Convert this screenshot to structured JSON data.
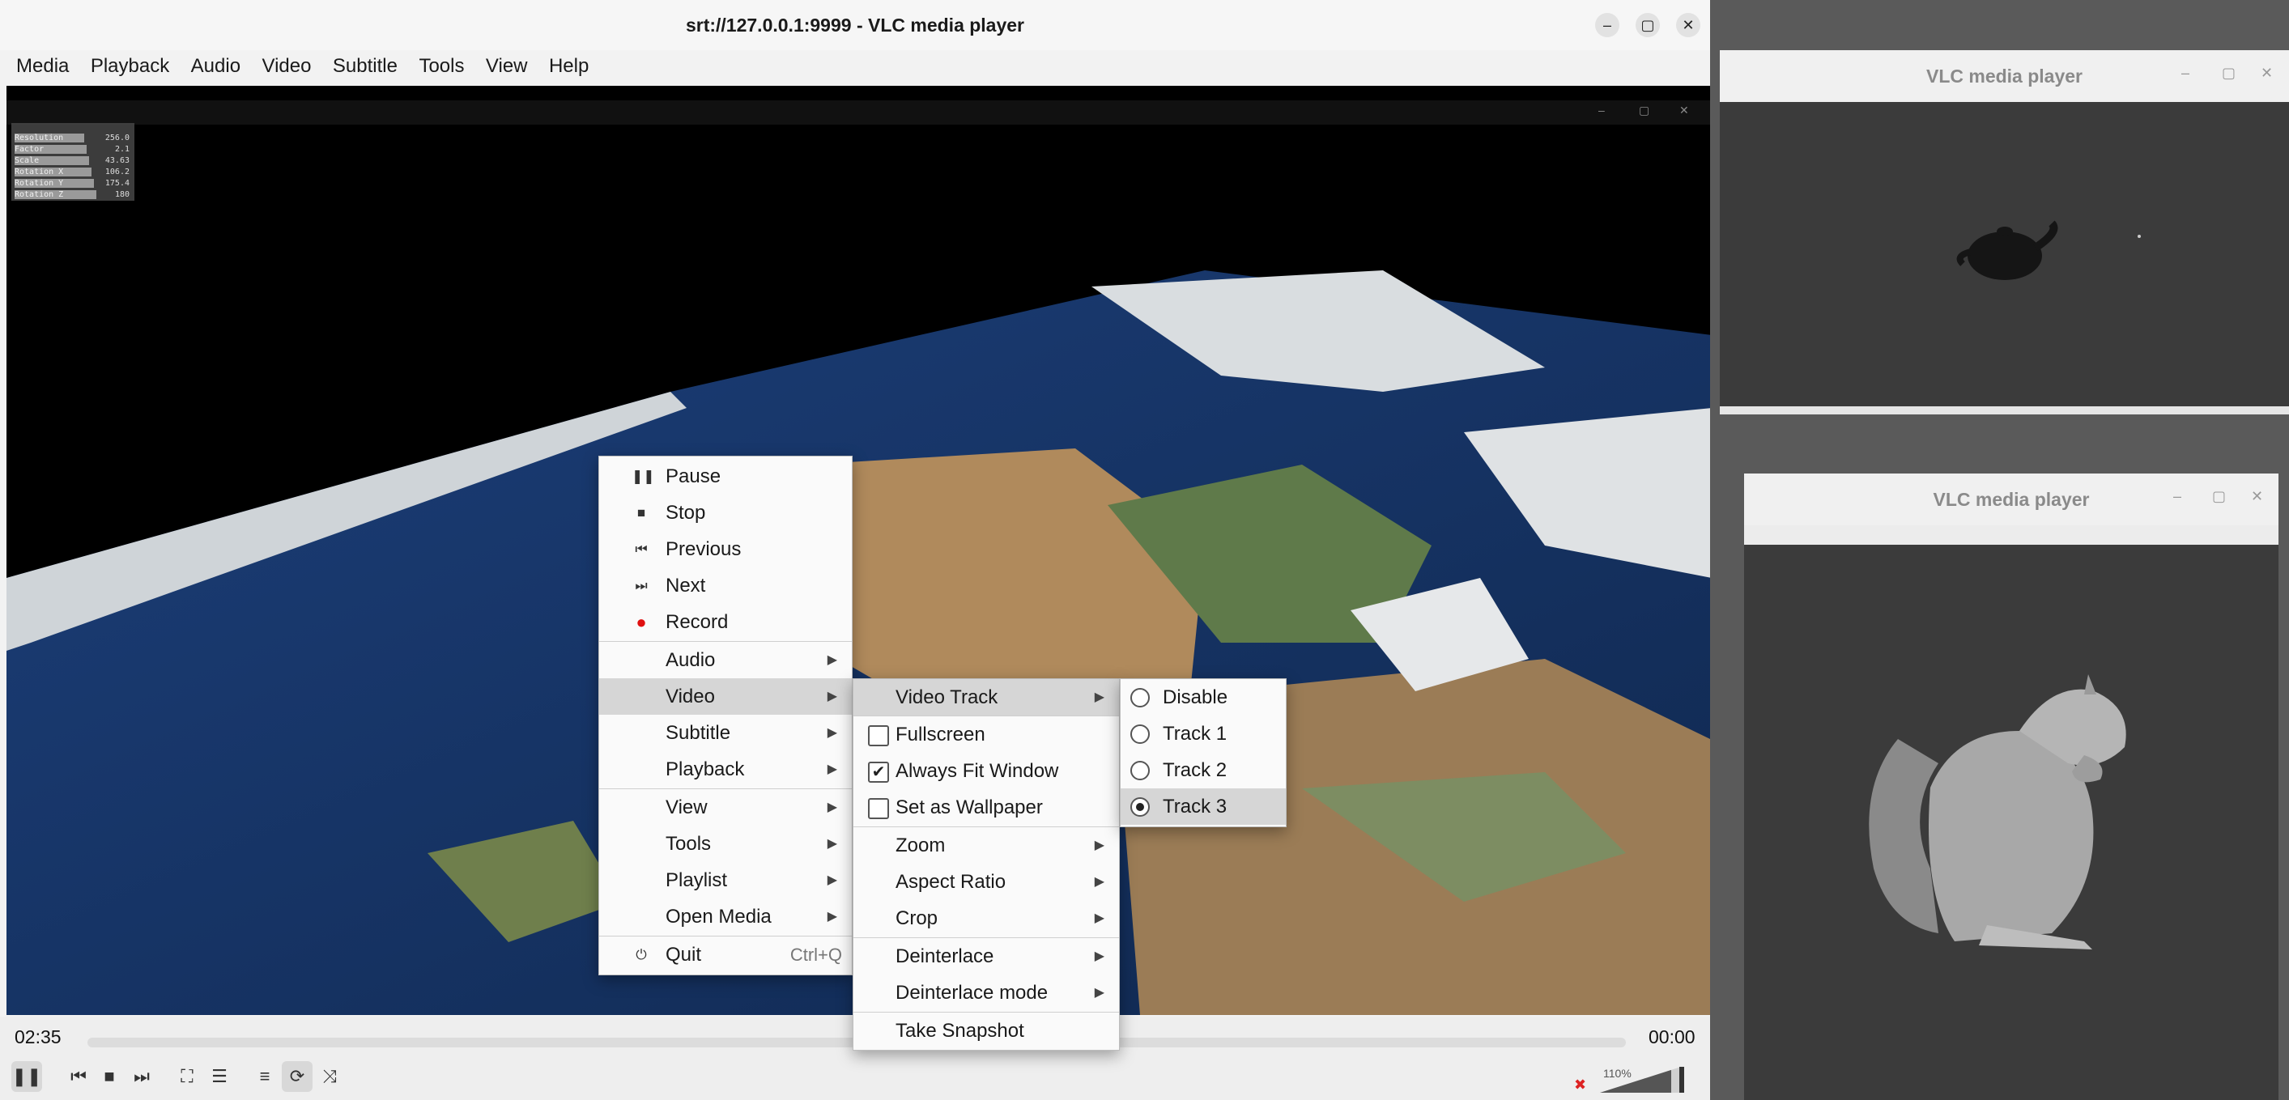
{
  "main_window": {
    "title": "srt://127.0.0.1:9999 - VLC media player",
    "menubar": [
      "Media",
      "Playback",
      "Audio",
      "Video",
      "Subtitle",
      "Tools",
      "View",
      "Help"
    ]
  },
  "overlay_panel": {
    "rows": [
      {
        "label": "Resolution",
        "value": "256.0"
      },
      {
        "label": "Factor",
        "value": "2.1"
      },
      {
        "label": "Scale",
        "value": "43.63"
      },
      {
        "label": "Rotation X",
        "value": "106.2"
      },
      {
        "label": "Rotation Y",
        "value": "175.4"
      },
      {
        "label": "Rotation Z",
        "value": "180"
      }
    ]
  },
  "controls": {
    "elapsed": "02:35",
    "remaining": "00:00",
    "volume": "110%",
    "volume_level": 1.1,
    "seek_fraction": 0.0
  },
  "context_menu": {
    "items": [
      {
        "icon": "pause-icon",
        "label": "Pause"
      },
      {
        "icon": "stop-icon",
        "label": "Stop"
      },
      {
        "icon": "previous-icon",
        "label": "Previous"
      },
      {
        "icon": "next-icon",
        "label": "Next"
      },
      {
        "icon": "record-icon",
        "label": "Record"
      },
      {
        "label": "Audio"
      },
      {
        "label": "Video"
      },
      {
        "label": "Subtitle"
      },
      {
        "label": "Playback"
      },
      {
        "label": "View"
      },
      {
        "label": "Tools"
      },
      {
        "label": "Playlist"
      },
      {
        "label": "Open Media"
      },
      {
        "icon": "quit-icon",
        "label": "Quit",
        "shortcut": "Ctrl+Q"
      }
    ]
  },
  "video_submenu": {
    "items": [
      {
        "label": "Video Track"
      },
      {
        "label": "Fullscreen",
        "checked": false
      },
      {
        "label": "Always Fit Window",
        "checked": true
      },
      {
        "label": "Set as Wallpaper",
        "checked": false
      },
      {
        "label": "Zoom"
      },
      {
        "label": "Aspect Ratio"
      },
      {
        "label": "Crop"
      },
      {
        "label": "Deinterlace"
      },
      {
        "label": "Deinterlace mode"
      },
      {
        "label": "Take Snapshot"
      }
    ]
  },
  "track_submenu": {
    "items": [
      {
        "label": "Disable",
        "selected": false
      },
      {
        "label": "Track 1",
        "selected": false
      },
      {
        "label": "Track 2",
        "selected": false
      },
      {
        "label": "Track 3",
        "selected": true
      }
    ]
  },
  "side_window_top": {
    "title": "VLC media player"
  },
  "side_window_bottom": {
    "title": "VLC media player"
  },
  "colors": {
    "record_red": "#e01010",
    "menu_highlight": "#d6d6d6"
  }
}
